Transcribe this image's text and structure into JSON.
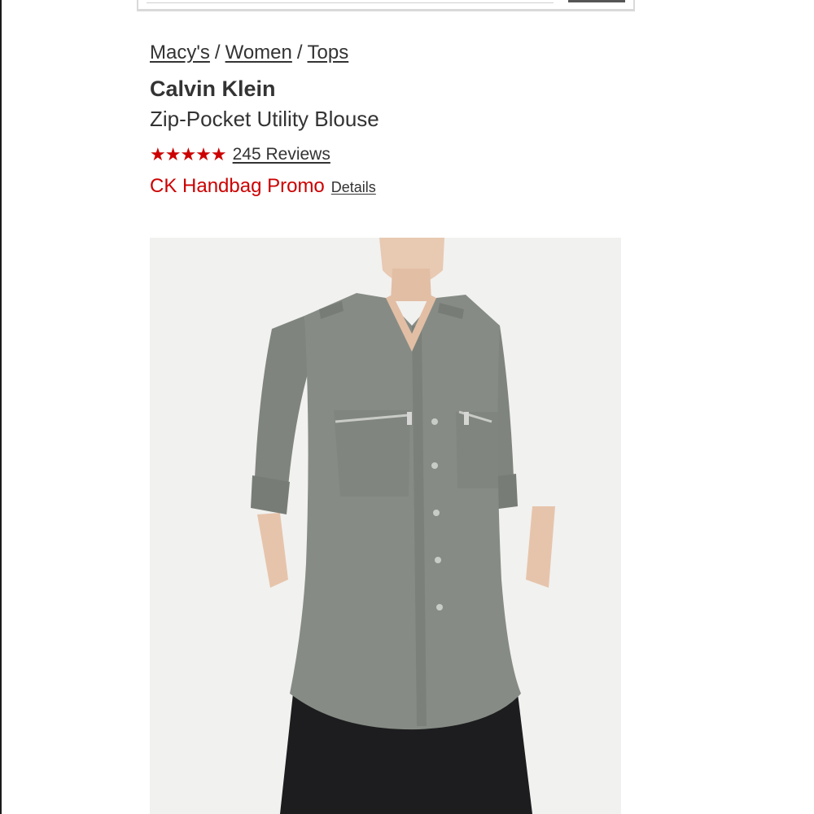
{
  "breadcrumb": {
    "items": [
      "Macy's",
      "Women",
      "Tops"
    ],
    "separator": "/"
  },
  "product": {
    "brand": "Calvin Klein",
    "name": "Zip-Pocket Utility Blouse",
    "rating": {
      "stars_display": "★★★★★",
      "value": 5,
      "out_of": 5,
      "reviews_label": "245 Reviews"
    },
    "promo": {
      "text": "CK Handbag Promo",
      "details_label": "Details"
    }
  },
  "colors": {
    "promo_red": "#cc0000",
    "star_red": "#cc0000",
    "text_dark": "#333333",
    "image_background": "#f1f1ef",
    "blouse_gray": "#858b84"
  },
  "icons": {
    "search_button": "search-button"
  }
}
